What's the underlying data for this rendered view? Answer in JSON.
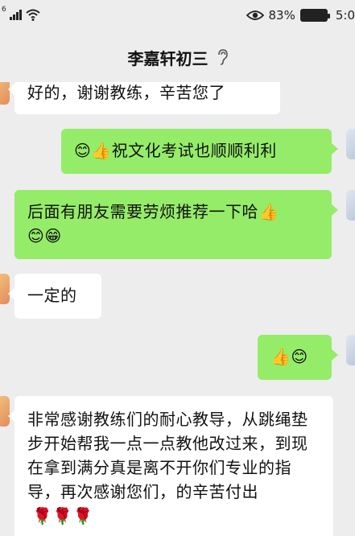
{
  "status_bar": {
    "network": "6",
    "battery_percent": "83%",
    "time": "5:0",
    "signal_icon": "signal-bars-icon",
    "wifi_icon": "wifi-icon",
    "eye_icon": "eye-icon",
    "battery_icon": "battery-icon"
  },
  "chat_header": {
    "title": "李嘉轩初三",
    "ear_icon": "ear-icon"
  },
  "messages": [
    {
      "side": "in",
      "text": "好的，谢谢教练，辛苦您了"
    },
    {
      "side": "out",
      "emoji": "😊👍",
      "text": "祝文化考试也顺顺利利"
    },
    {
      "side": "out",
      "text": "后面有朋友需要劳烦推荐一下哈",
      "emoji": "👍",
      "emoji2": "😊😁"
    },
    {
      "side": "in",
      "text": "一定的"
    },
    {
      "side": "out",
      "emoji": "👍😊"
    },
    {
      "side": "in",
      "text": "非常感谢教练们的耐心教导，从跳绳垫步开始帮我一点一点教他改过来，到现在拿到满分真是离不开你们专业的指导，再次感谢您们，的辛苦付出",
      "emoji": "🌹🌹🌹"
    }
  ],
  "colors": {
    "background": "#ededed",
    "incoming_bubble": "#ffffff",
    "outgoing_bubble": "#95ec69"
  }
}
